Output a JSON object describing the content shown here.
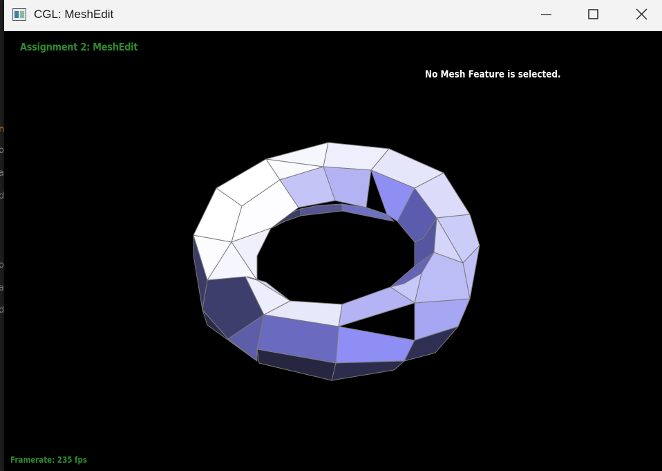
{
  "window": {
    "title": "CGL: MeshEdit",
    "controls": {
      "minimize_icon": "minimize-icon",
      "maximize_icon": "maximize-icon",
      "close_icon": "close-icon"
    }
  },
  "hud": {
    "assignment_title": "Assignment 2: MeshEdit",
    "selection_status": "No Mesh Feature is selected.",
    "framerate": "Framerate: 235 fps"
  },
  "viewport": {
    "background": "#000000",
    "mesh": {
      "shape": "torus",
      "render": "flat-shaded triangles with wireframe",
      "edge_color": "#7a7a7a",
      "face_color_light": "#f4f4fb",
      "face_color_mid": "#9a9af5",
      "face_color_dark": "#2a2a4a"
    }
  },
  "colors": {
    "hud_green": "#2e8b2e",
    "hud_white": "#ffffff",
    "titlebar": "#f3f3f3"
  }
}
